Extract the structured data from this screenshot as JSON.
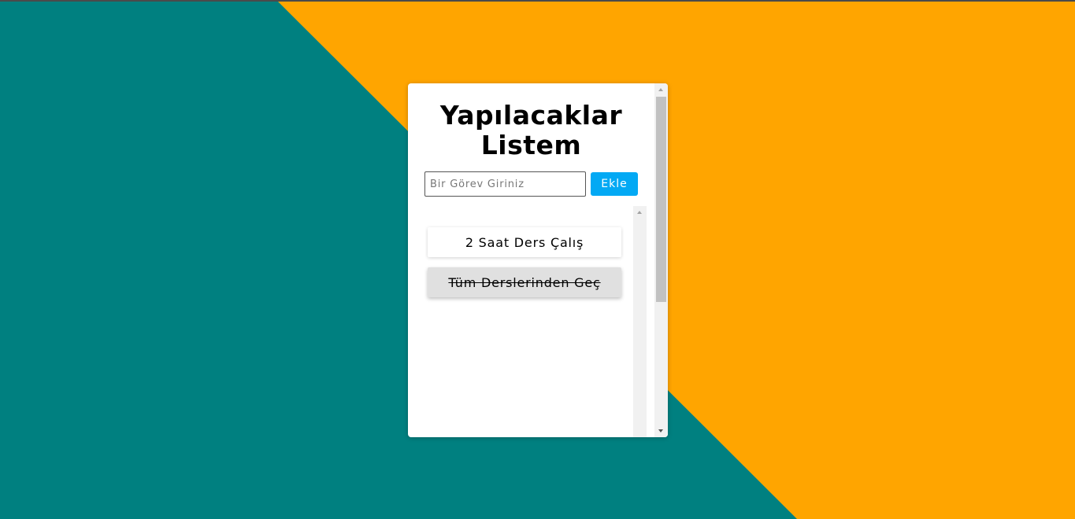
{
  "colors": {
    "background_teal": "#008080",
    "background_orange": "#ffa500",
    "add_button": "#03a9f4",
    "done_task_bg": "#e0e0e0"
  },
  "header": {
    "title": "Yapılacaklar Listem"
  },
  "form": {
    "input_placeholder": "Bir Görev Giriniz",
    "input_value": "",
    "add_label": "Ekle"
  },
  "tasks": [
    {
      "text": "2 Saat Ders Çalış",
      "done": false
    },
    {
      "text": "Tüm Derslerinden Geç",
      "done": true
    }
  ]
}
